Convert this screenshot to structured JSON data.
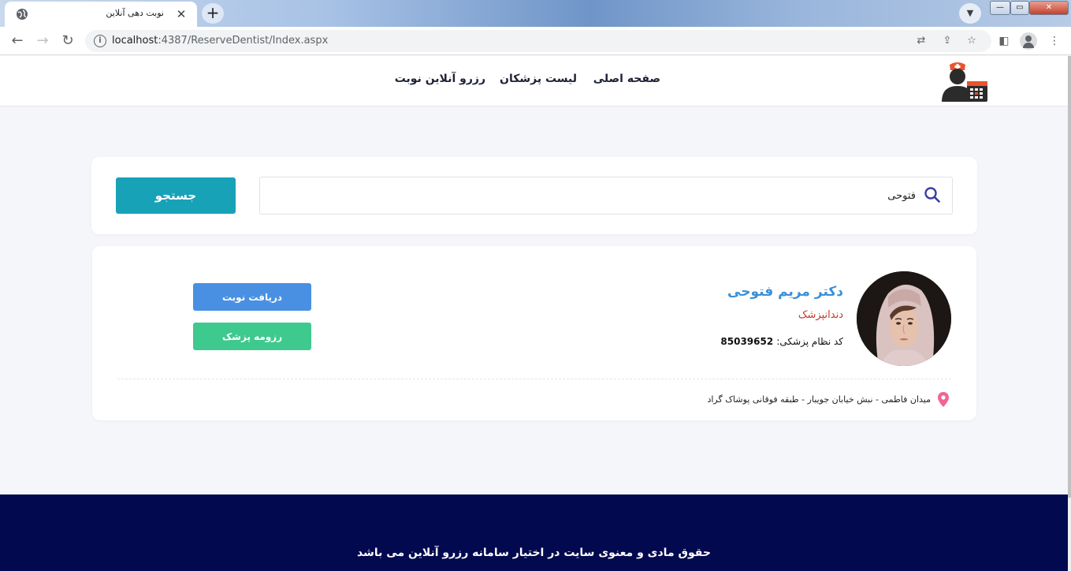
{
  "browser": {
    "tab_title": "نوبت دهی آنلاین",
    "url_host": "localhost",
    "url_rest": ":4387/ReserveDentist/Index.aspx",
    "new_tab_symbol": "+",
    "close_symbol": "✕"
  },
  "nav": {
    "items": [
      {
        "label": "صفحه اصلی"
      },
      {
        "label": "لیست پزشکان"
      },
      {
        "label": "رزرو آنلاین نوبت"
      }
    ]
  },
  "search": {
    "value": "فتوحی",
    "button_label": "جستجو"
  },
  "doctor": {
    "name": "دکتر مریم فتوحی",
    "specialty": "دندانپزشک",
    "code_label": "کد نظام پزشکی:",
    "code_value": "85039652",
    "appointment_button": "دریافت نوبت",
    "resume_button": "رزومه پزشک",
    "address": "میدان فاطمی - نبش خیابان جویبار - طبقه فوقانی پوشاک گراد"
  },
  "footer": {
    "text": "حقوق مادی و معنوی سایت در اختیار سامانه رزرو آنلاین می باشد"
  },
  "colors": {
    "footer_bg": "#03094e",
    "search_button": "#17a2b8",
    "appointment_button": "#4a90e2",
    "resume_button": "#3ec98e",
    "doctor_name": "#3a8fd8",
    "specialty": "#c0392b"
  }
}
